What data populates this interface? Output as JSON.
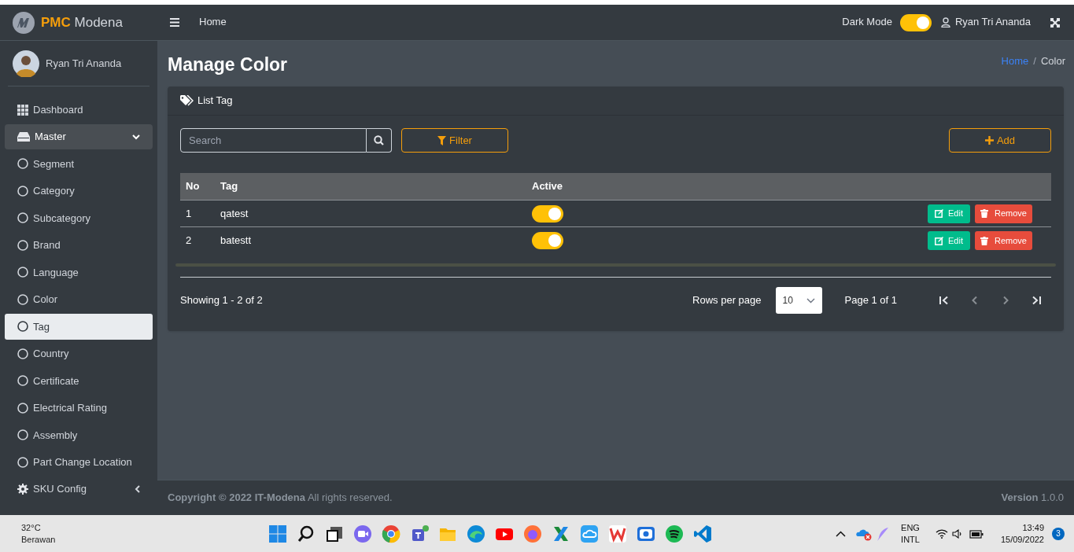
{
  "brand": {
    "bold": "PMC",
    "rest": "Modena"
  },
  "user": {
    "name": "Ryan Tri Ananda"
  },
  "sidebar": {
    "items": [
      {
        "kind": "link",
        "label": "Dashboard",
        "selected": false
      },
      {
        "kind": "group",
        "label": "Master",
        "expanded": true,
        "children": [
          {
            "label": "Segment",
            "selected": false
          },
          {
            "label": "Category",
            "selected": false
          },
          {
            "label": "Subcategory",
            "selected": false
          },
          {
            "label": "Brand",
            "selected": false
          },
          {
            "label": "Language",
            "selected": false
          },
          {
            "label": "Color",
            "selected": false
          },
          {
            "label": "Tag",
            "selected": true
          },
          {
            "label": "Country",
            "selected": false
          },
          {
            "label": "Certificate",
            "selected": false
          },
          {
            "label": "Electrical Rating",
            "selected": false
          },
          {
            "label": "Assembly",
            "selected": false
          },
          {
            "label": "Part Change Location",
            "selected": false
          }
        ]
      },
      {
        "kind": "group",
        "label": "SKU Config",
        "expanded": false
      }
    ]
  },
  "header": {
    "nav": "Home",
    "dark_mode_label": "Dark Mode",
    "dark_mode_on": true,
    "user": "Ryan Tri Ananda"
  },
  "page": {
    "title": "Manage Color",
    "breadcrumb": [
      {
        "label": "Home",
        "link": true
      },
      {
        "label": "Color",
        "link": false
      }
    ],
    "breadcrumb_separator": "/"
  },
  "card": {
    "title": "List Tag",
    "search": {
      "placeholder": "Search"
    },
    "filter": "Filter",
    "add": "Add",
    "table": {
      "columns": [
        "No",
        "Tag",
        "Active"
      ],
      "rows": [
        {
          "no": "1",
          "tag": "qatest",
          "active": true,
          "edit": "Edit",
          "remove": "Remove"
        },
        {
          "no": "2",
          "tag": "batestt",
          "active": true,
          "edit": "Edit",
          "remove": "Remove"
        }
      ]
    },
    "footer": {
      "showing": "Showing 1 - 2 of 2",
      "rows_per_page": "Rows per page",
      "page_size": "10",
      "page_info": "Page 1 of 1"
    }
  },
  "footer": {
    "copyright": "**Copyright © 2022 IT-Modena** All rights reserved.",
    "version": "**Version** 1.0.0"
  },
  "taskbar": {
    "weather": {
      "temp": "32°C",
      "condition": "Berawan"
    },
    "lang": "ENG",
    "layout": "INTL",
    "time": "13:49",
    "date": "15/09/2022",
    "notifications": "3"
  }
}
